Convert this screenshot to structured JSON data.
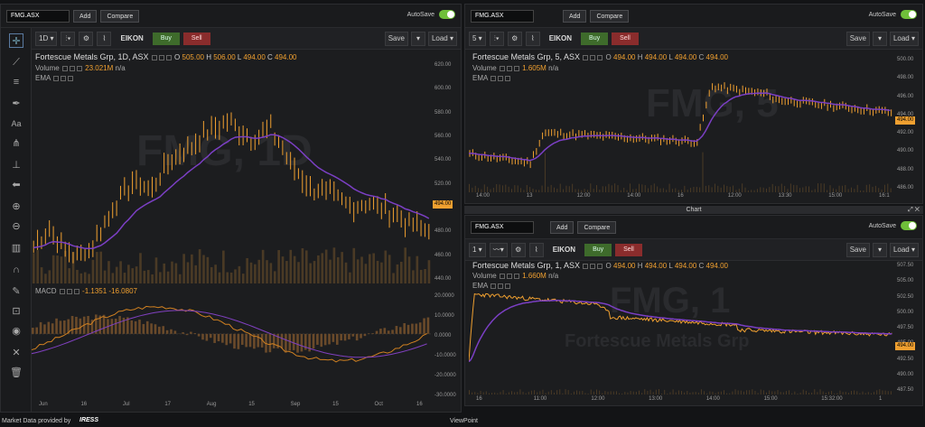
{
  "app": {
    "footer_left": "Market Data provided by",
    "footer_brand": "IRESS",
    "footer_center": "ViewPoint",
    "window_title": "Chart"
  },
  "common": {
    "add_label": "Add",
    "compare_label": "Compare",
    "autosave_label": "AutoSave",
    "eikon_label": "EIKON",
    "buy_label": "Buy",
    "sell_label": "Sell",
    "save_label": "Save",
    "load_label": "Load",
    "icons": [
      "crosshair-icon",
      "line-icon",
      "hamburger-icon",
      "pen-icon",
      "text-icon",
      "fork-icon",
      "level-icon",
      "back-arrow-icon",
      "zoom-in-icon",
      "zoom-out-icon",
      "bars-icon",
      "magnet-icon",
      "pencil-icon",
      "lock-icon",
      "eye-icon",
      "cross-icon",
      "trash-icon"
    ]
  },
  "left_chart": {
    "symbol": "FMG.ASX",
    "interval": "1D",
    "title": "Fortescue Metals Grp, 1D, ASX",
    "ohlc": {
      "o_label": "O",
      "o": "505.00",
      "h_label": "H",
      "h": "506.00",
      "l_label": "L",
      "l": "494.00",
      "c_label": "C",
      "c": "494.00"
    },
    "volume_label": "Volume",
    "volume_value": "23.021M",
    "volume_extra": "n/a",
    "ema_label": "EMA",
    "macd_label": "MACD",
    "macd_values": "-1.1351 -16.0807",
    "price_axis": [
      "620.00",
      "600.00",
      "580.00",
      "560.00",
      "540.00",
      "520.00",
      "500.00",
      "480.00",
      "460.00",
      "440.00"
    ],
    "last_price": "494.00",
    "macd_axis": [
      "20.0000",
      "10.0000",
      "0.0000",
      "-10.0000",
      "-20.0000",
      "-30.0000"
    ],
    "x_labels": [
      "Jun",
      "16",
      "Jul",
      "17",
      "Aug",
      "15",
      "Sep",
      "15",
      "Oct",
      "16"
    ],
    "watermark": "FMG, 1D"
  },
  "right_top_chart": {
    "symbol": "FMG.ASX",
    "interval": "5",
    "title": "Fortescue Metals Grp, 5, ASX",
    "ohlc": {
      "o_label": "O",
      "o": "494.00",
      "h_label": "H",
      "h": "494.00",
      "l_label": "L",
      "l": "494.00",
      "c_label": "C",
      "c": "494.00"
    },
    "volume_label": "Volume",
    "volume_value": "1.605M",
    "volume_extra": "n/a",
    "ema_label": "EMA",
    "price_axis": [
      "500.00",
      "498.00",
      "496.00",
      "494.00",
      "492.00",
      "490.00",
      "488.00",
      "486.00"
    ],
    "last_price": "494.00",
    "x_labels": [
      "14:00",
      "13",
      "12:00",
      "14:00",
      "16",
      "12:00",
      "13:30",
      "15:00",
      "16:1"
    ],
    "watermark": "FMG, 5"
  },
  "right_bottom_chart": {
    "symbol": "FMG.ASX",
    "interval": "1",
    "title": "Fortescue Metals Grp, 1, ASX",
    "ohlc": {
      "o_label": "O",
      "o": "494.00",
      "h_label": "H",
      "h": "494.00",
      "l_label": "L",
      "l": "494.00",
      "c_label": "C",
      "c": "494.00"
    },
    "volume_label": "Volume",
    "volume_value": "1.660M",
    "volume_extra": "n/a",
    "ema_label": "EMA",
    "price_axis": [
      "507.50",
      "505.00",
      "502.50",
      "500.00",
      "497.50",
      "495.00",
      "492.50",
      "490.00",
      "487.50"
    ],
    "last_price": "494.00",
    "x_labels": [
      "16",
      "11:00",
      "12:00",
      "13:00",
      "14:00",
      "15:00",
      "15:32:00",
      "1"
    ],
    "watermark": "FMG, 1",
    "watermark_sub": "Fortescue Metals Grp"
  },
  "colors": {
    "candle": "#f0a030",
    "ema": "#7b3fc4",
    "macd_hist": "#6a4a2a",
    "volume": "#4a3a25"
  }
}
